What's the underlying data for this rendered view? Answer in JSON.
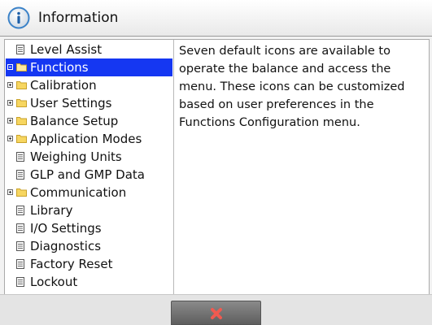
{
  "header": {
    "title": "Information",
    "icon": "info-circle-icon",
    "accent_color": "#3b82c8"
  },
  "tree": {
    "selected_color": "#1537f2",
    "items": [
      {
        "label": "Level Assist",
        "icon": "document-icon",
        "expandable": false,
        "selected": false
      },
      {
        "label": "Functions",
        "icon": "folder-icon",
        "expandable": true,
        "selected": true
      },
      {
        "label": "Calibration",
        "icon": "folder-icon",
        "expandable": true,
        "selected": false
      },
      {
        "label": "User Settings",
        "icon": "folder-icon",
        "expandable": true,
        "selected": false
      },
      {
        "label": "Balance Setup",
        "icon": "folder-icon",
        "expandable": true,
        "selected": false
      },
      {
        "label": "Application Modes",
        "icon": "folder-icon",
        "expandable": true,
        "selected": false
      },
      {
        "label": "Weighing Units",
        "icon": "document-icon",
        "expandable": false,
        "selected": false
      },
      {
        "label": "GLP and GMP Data",
        "icon": "document-icon",
        "expandable": false,
        "selected": false
      },
      {
        "label": "Communication",
        "icon": "folder-icon",
        "expandable": true,
        "selected": false
      },
      {
        "label": "Library",
        "icon": "document-icon",
        "expandable": false,
        "selected": false
      },
      {
        "label": "I/O Settings",
        "icon": "document-icon",
        "expandable": false,
        "selected": false
      },
      {
        "label": "Diagnostics",
        "icon": "document-icon",
        "expandable": false,
        "selected": false
      },
      {
        "label": "Factory Reset",
        "icon": "document-icon",
        "expandable": false,
        "selected": false
      },
      {
        "label": "Lockout",
        "icon": "document-icon",
        "expandable": false,
        "selected": false
      }
    ]
  },
  "detail": {
    "lines": [
      "Seven default icons are available to",
      "operate the balance and access the",
      "menu. These icons can be customized",
      "based on user preferences in the",
      "Functions Configuration menu."
    ]
  },
  "footer": {
    "cancel_icon": "close-x-icon",
    "cancel_color": "#e53935"
  }
}
